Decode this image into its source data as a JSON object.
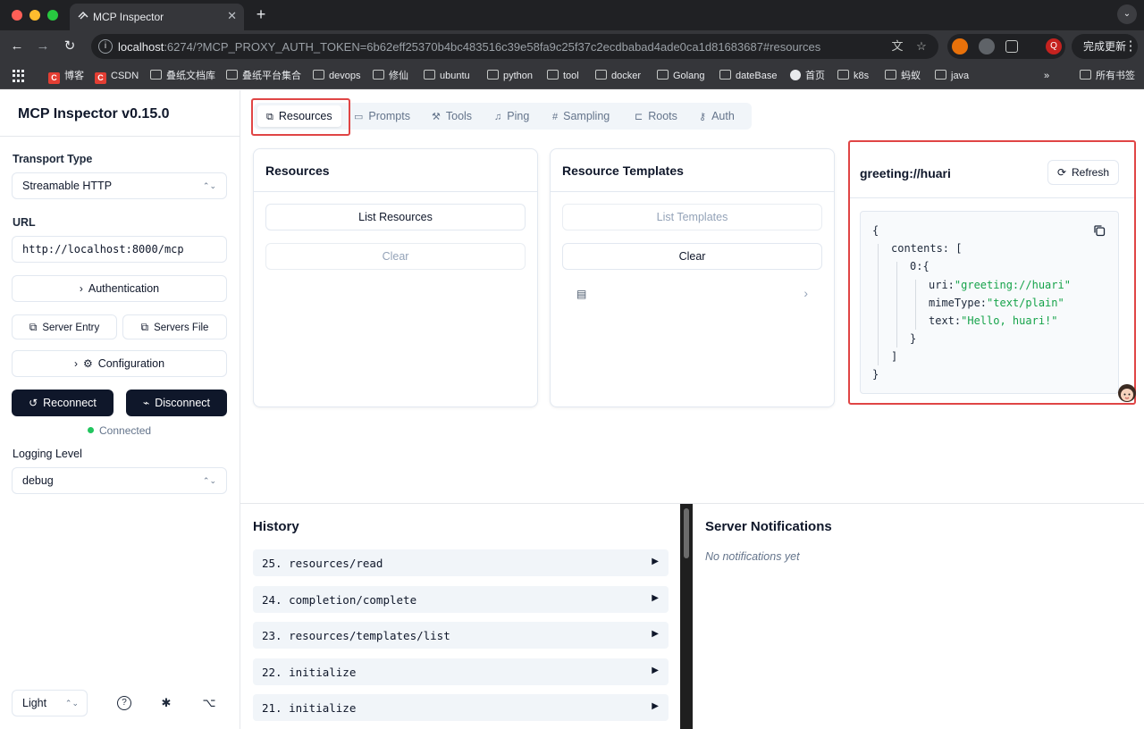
{
  "browser": {
    "tab_title": "MCP Inspector",
    "url_host": "localhost",
    "url_rest": ":6274/?MCP_PROXY_AUTH_TOKEN=6b62eff25370b4bc483516c39e58fa9c25f37c2ecdbabad4ade0ca1d81683687#resources",
    "update_label": "完成更新",
    "profile_initial": "Q",
    "bookmarks": [
      "博客",
      "CSDN",
      "叠纸文档库",
      "叠纸平台集合",
      "devops",
      "修仙",
      "ubuntu",
      "python",
      "tool",
      "docker",
      "Golang",
      "dateBase",
      "首页",
      "k8s",
      "蚂蚁",
      "java"
    ],
    "more_bookmarks": "»",
    "all_bookmarks": "所有书签"
  },
  "sidebar": {
    "title": "MCP Inspector v0.15.0",
    "transport_label": "Transport Type",
    "transport_value": "Streamable HTTP",
    "url_label": "URL",
    "url_value": "http://localhost:8000/mcp",
    "authentication_label": "Authentication",
    "server_entry_label": "Server Entry",
    "servers_file_label": "Servers File",
    "configuration_label": "Configuration",
    "reconnect_label": "Reconnect",
    "disconnect_label": "Disconnect",
    "status_text": "Connected",
    "status_color": "#22c55e",
    "logging_label": "Logging Level",
    "logging_value": "debug",
    "theme_value": "Light"
  },
  "tabs": [
    {
      "label": "Resources",
      "icon": "copy-icon",
      "active": true
    },
    {
      "label": "Prompts",
      "icon": "message-icon"
    },
    {
      "label": "Tools",
      "icon": "hammer-icon"
    },
    {
      "label": "Ping",
      "icon": "bell-icon"
    },
    {
      "label": "Sampling",
      "icon": "hash-icon"
    },
    {
      "label": "Roots",
      "icon": "folder-tree-icon"
    },
    {
      "label": "Auth",
      "icon": "key-icon"
    }
  ],
  "resources_panel": {
    "title": "Resources",
    "list_label": "List Resources",
    "clear_label": "Clear"
  },
  "templates_panel": {
    "title": "Resource Templates",
    "list_label": "List Templates",
    "clear_label": "Clear"
  },
  "detail_panel": {
    "title": "greeting://huari",
    "refresh_label": "Refresh",
    "json": {
      "open_brace": "{",
      "contents_key": "contents:",
      "open_bracket": "[",
      "index_key": "0:",
      "inner_open": "{",
      "uri_key": "uri:",
      "uri_value": "\"greeting://huari\"",
      "mime_key": "mimeType:",
      "mime_value": "\"text/plain\"",
      "text_key": "text:",
      "text_value": "\"Hello, huari!\"",
      "inner_close": "}",
      "close_bracket": "]",
      "close_brace": "}"
    }
  },
  "history": {
    "title": "History",
    "items": [
      {
        "label": "25. resources/read"
      },
      {
        "label": "24. completion/complete"
      },
      {
        "label": "23. resources/templates/list"
      },
      {
        "label": "22. initialize"
      },
      {
        "label": "21. initialize"
      }
    ],
    "expand_glyph": "▶"
  },
  "notifications": {
    "title": "Server Notifications",
    "empty_text": "No notifications yet"
  },
  "colors": {
    "highlight": "#e04545",
    "primary_dark": "#0f172a",
    "json_string": "#16a34a"
  }
}
